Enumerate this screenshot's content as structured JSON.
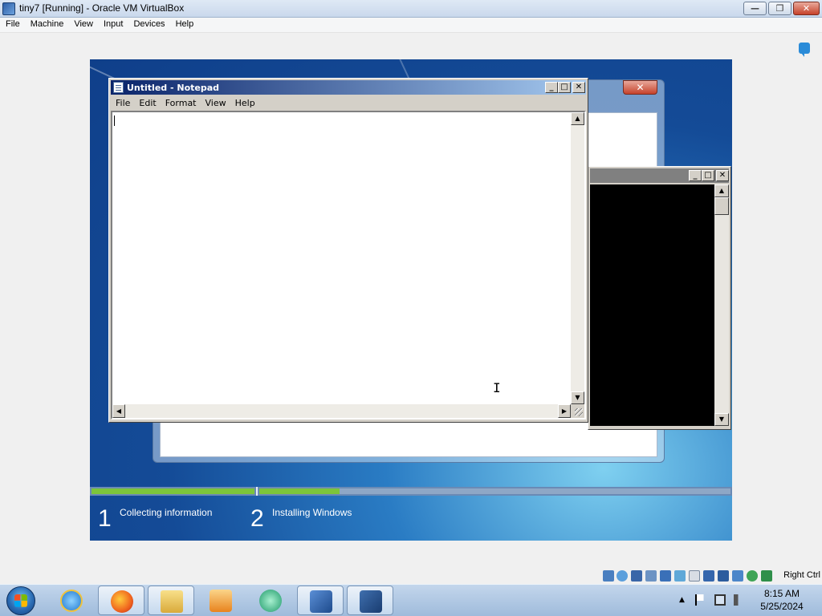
{
  "host": {
    "title": "tiny7 [Running] - Oracle VM VirtualBox",
    "menu": [
      "File",
      "Machine",
      "View",
      "Input",
      "Devices",
      "Help"
    ],
    "host_key": "Right Ctrl"
  },
  "notepad": {
    "title": "Untitled - Notepad",
    "menu": [
      "File",
      "Edit",
      "Format",
      "View",
      "Help"
    ],
    "content": ""
  },
  "setup": {
    "steps": [
      {
        "number": "1",
        "label": "Collecting information"
      },
      {
        "number": "2",
        "label": "Installing Windows"
      }
    ],
    "progress": {
      "step1_fraction": 1.0,
      "step2_fraction": 0.17
    }
  },
  "clock": {
    "time": "8:15 AM",
    "date": "5/25/2024"
  },
  "taskbar": {
    "apps": [
      "internet-explorer",
      "firefox",
      "windows-explorer",
      "media-player",
      "app-green",
      "virtualbox",
      "tiny7"
    ]
  },
  "colors": {
    "accent": "#0a246a",
    "progress_green": "#7cc53b",
    "close_red": "#c6422a"
  }
}
